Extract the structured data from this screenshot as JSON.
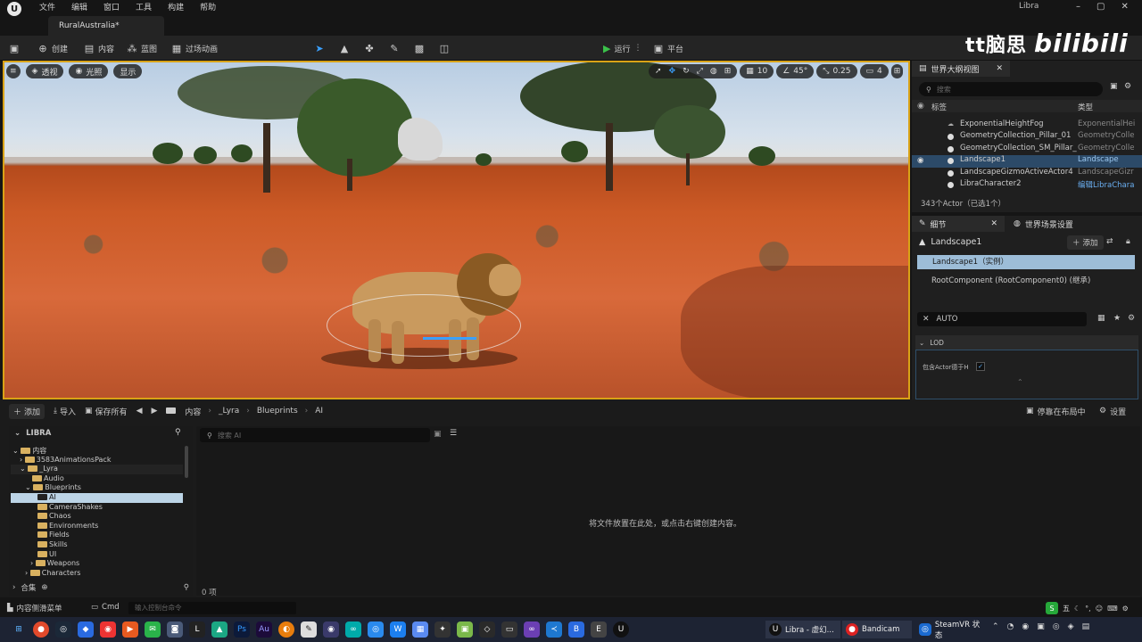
{
  "menu": {
    "items": [
      "文件",
      "编辑",
      "窗口",
      "工具",
      "构建",
      "帮助"
    ]
  },
  "app_title": "Libra",
  "level_tab": "RuralAustralia*",
  "toolbar": {
    "create": "创建",
    "content": "内容",
    "blueprint": "蓝图",
    "cinematics": "过场动画",
    "run": "运行",
    "platform": "平台"
  },
  "watermark": {
    "left": "tt脑思",
    "right": "bilibili"
  },
  "viewport": {
    "perspective": "透视",
    "lit": "光照",
    "show": "显示",
    "grid_snap": "10",
    "rotation_snap": "45°",
    "scale_snap": "0.25",
    "camera_speed": "4"
  },
  "outliner": {
    "tab": "世界大纲视图",
    "search_placeholder": "搜索",
    "col_label": "标签",
    "col_type": "类型",
    "rows": [
      {
        "name": "ExponentialHeightFog",
        "type": "ExponentialHei"
      },
      {
        "name": "GeometryCollection_Pillar_01",
        "type": "GeometryColle"
      },
      {
        "name": "GeometryCollection_SM_Pillar_",
        "type": "GeometryColle"
      },
      {
        "name": "Landscape1",
        "type": "Landscape"
      },
      {
        "name": "LandscapeGizmoActiveActor4",
        "type": "LandscapeGizr"
      },
      {
        "name": "LibraCharacter2",
        "type": "编辑LibraChara"
      }
    ],
    "count": "343个Actor（已选1个）"
  },
  "details": {
    "tab": "细节",
    "tab2": "世界场景设置",
    "actor": "Landscape1",
    "add": "添加",
    "instance": "Landscape1（实例）",
    "root": "RootComponent (RootComponent0) (继承)",
    "filter": "AUTO",
    "section": "LOD",
    "prop": "包含Actor德于H"
  },
  "content_browser": {
    "add": "添加",
    "import": "导入",
    "save_all": "保存所有",
    "path": [
      "内容",
      "_Lyra",
      "Blueprints",
      "AI"
    ],
    "dock": "停靠在布局中",
    "settings": "设置",
    "root": "LIBRA",
    "search_placeholder": "搜索 AI",
    "empty": "将文件放置在此处，或点击右键创建内容。",
    "item_count": "0 项",
    "collections": "合集",
    "tree": [
      {
        "label": "内容",
        "indent": 0
      },
      {
        "label": "3583AnimationsPack",
        "indent": 1
      },
      {
        "label": "_Lyra",
        "indent": 1
      },
      {
        "label": "Audio",
        "indent": 2
      },
      {
        "label": "Blueprints",
        "indent": 2
      },
      {
        "label": "AI",
        "indent": 3,
        "selected": true
      },
      {
        "label": "CameraShakes",
        "indent": 3
      },
      {
        "label": "Chaos",
        "indent": 3
      },
      {
        "label": "Environments",
        "indent": 3
      },
      {
        "label": "Fields",
        "indent": 3
      },
      {
        "label": "Skills",
        "indent": 3
      },
      {
        "label": "UI",
        "indent": 3
      },
      {
        "label": "Weapons",
        "indent": 3
      },
      {
        "label": "Characters",
        "indent": 2
      }
    ]
  },
  "statusbar": {
    "drawer": "内容侧滑菜单",
    "cmd": "Cmd",
    "console_placeholder": "输入控制台命令"
  },
  "taskbar": {
    "libra": "Libra - 虚幻...",
    "bandicam": "Bandicam",
    "steamvr": "SteamVR 状态",
    "ime": "五"
  },
  "colors": {
    "selection": "#2c4a68",
    "viewport_border": "#d9a216",
    "run": "#3bc14a"
  }
}
